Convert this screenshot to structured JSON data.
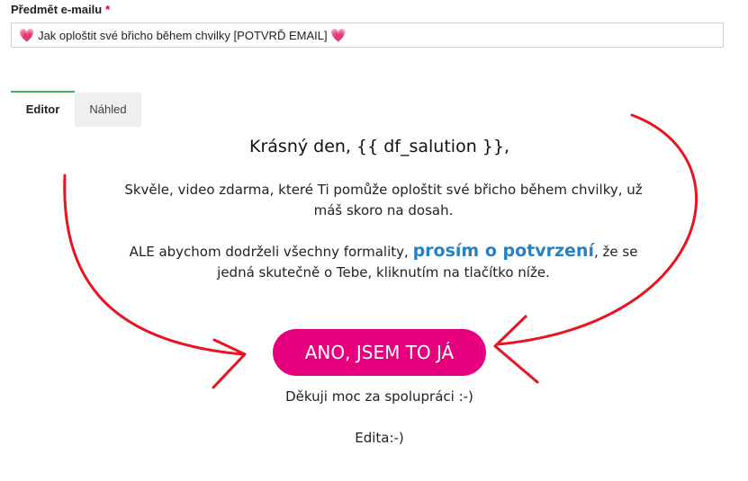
{
  "subject": {
    "label": "Předmět e-mailu",
    "required_mark": "*",
    "value": "Jak oploštit své břicho během chvilky  [POTVRĎ EMAIL]",
    "heart": "💗"
  },
  "tabs": [
    {
      "label": "Editor",
      "active": true
    },
    {
      "label": "Náhled",
      "active": false
    }
  ],
  "email": {
    "greeting": "Krásný den, {{ df_salution }},",
    "paragraph1": "Skvěle, video zdarma, které Ti pomůže oploštit své břicho během chvilky, už máš skoro na dosah.",
    "paragraph2_before": "ALE abychom dodrželi všechny formality, ",
    "paragraph2_highlight": "prosím o potvrzení",
    "paragraph2_after": ", že se jedná skutečně o Tebe, kliknutím na tlačítko níže.",
    "button_label": "ANO, JSEM TO JÁ",
    "thanks": "Děkuji moc za spolupráci :-)",
    "signature": "Edita:-)"
  },
  "colors": {
    "button": "#e6007e",
    "highlight": "#2a7fc0",
    "arrows": "#e8141e",
    "active_tab_border": "#4caf50",
    "required": "#d9001b"
  },
  "icons": [
    "heart-icon",
    "curved-arrow-annotation"
  ]
}
